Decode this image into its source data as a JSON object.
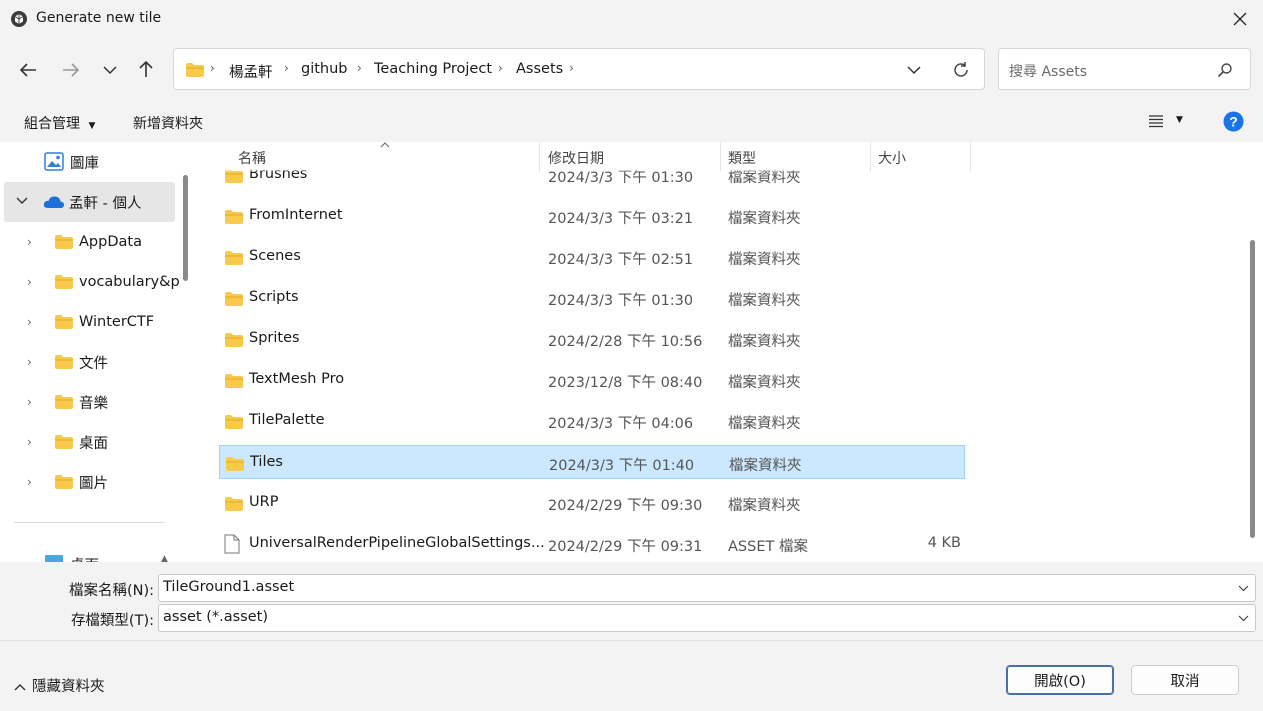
{
  "window": {
    "title": "Generate new tile"
  },
  "breadcrumb": [
    "楊孟軒",
    "github",
    "Teaching Project",
    "Assets"
  ],
  "search": {
    "placeholder": "搜尋 Assets"
  },
  "toolbar": {
    "organize_label": "組合管理",
    "new_folder_label": "新增資料夾"
  },
  "sidebar": {
    "items": [
      {
        "label": "圖庫",
        "icon": "gallery-icon"
      },
      {
        "label": "孟軒 - 個人",
        "icon": "onedrive-cloud-icon"
      },
      {
        "label": "AppData",
        "icon": "folder-icon"
      },
      {
        "label": "vocabulary&p",
        "icon": "folder-icon"
      },
      {
        "label": "WinterCTF",
        "icon": "folder-icon"
      },
      {
        "label": "文件",
        "icon": "folder-icon"
      },
      {
        "label": "音樂",
        "icon": "folder-icon"
      },
      {
        "label": "桌面",
        "icon": "folder-icon"
      },
      {
        "label": "圖片",
        "icon": "folder-icon"
      },
      {
        "label": "桌面",
        "icon": "desktop-icon"
      }
    ]
  },
  "columns": {
    "name": "名稱",
    "date": "修改日期",
    "type": "類型",
    "size": "大小"
  },
  "files": [
    {
      "name": "Brushes",
      "date": "2024/3/3 下午 01:30",
      "type": "檔案資料夾",
      "size": "",
      "kind": "folder"
    },
    {
      "name": "FromInternet",
      "date": "2024/3/3 下午 03:21",
      "type": "檔案資料夾",
      "size": "",
      "kind": "folder"
    },
    {
      "name": "Scenes",
      "date": "2024/3/3 下午 02:51",
      "type": "檔案資料夾",
      "size": "",
      "kind": "folder"
    },
    {
      "name": "Scripts",
      "date": "2024/3/3 下午 01:30",
      "type": "檔案資料夾",
      "size": "",
      "kind": "folder"
    },
    {
      "name": "Sprites",
      "date": "2024/2/28 下午 10:56",
      "type": "檔案資料夾",
      "size": "",
      "kind": "folder"
    },
    {
      "name": "TextMesh Pro",
      "date": "2023/12/8 下午 08:40",
      "type": "檔案資料夾",
      "size": "",
      "kind": "folder"
    },
    {
      "name": "TilePalette",
      "date": "2024/3/3 下午 04:06",
      "type": "檔案資料夾",
      "size": "",
      "kind": "folder"
    },
    {
      "name": "Tiles",
      "date": "2024/3/3 下午 01:40",
      "type": "檔案資料夾",
      "size": "",
      "kind": "folder",
      "selected": true
    },
    {
      "name": "URP",
      "date": "2024/2/29 下午 09:30",
      "type": "檔案資料夾",
      "size": "",
      "kind": "folder"
    },
    {
      "name": "UniversalRenderPipelineGlobalSettings...",
      "date": "2024/2/29 下午 09:31",
      "type": "ASSET 檔案",
      "size": "4 KB",
      "kind": "file"
    }
  ],
  "filename": {
    "label": "檔案名稱(N):",
    "value": "TileGround1.asset"
  },
  "filetype": {
    "label": "存檔類型(T):",
    "value": "asset (*.asset)"
  },
  "buttons": {
    "open": "開啟(O)",
    "cancel": "取消",
    "hide_folders": "隱藏資料夾"
  },
  "colors": {
    "folder": "#f8c94a",
    "selection": "#cce8ff",
    "help": "#1a73e8",
    "onedrive": "#1e6fd9"
  }
}
